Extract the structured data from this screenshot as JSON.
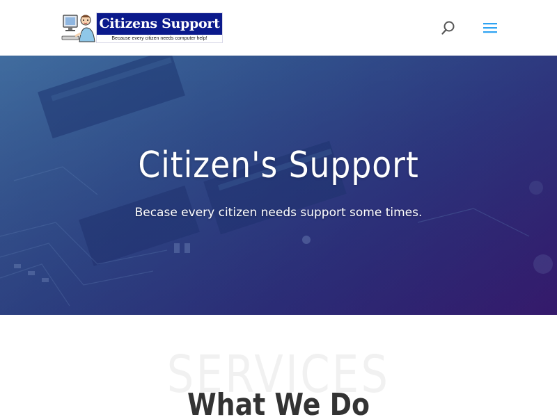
{
  "header": {
    "logo": {
      "title": "Citizens Support",
      "tagline": "Because every citizen needs computer help!"
    },
    "search_icon": "search-icon",
    "menu_icon": "hamburger-menu-icon",
    "accent_color": "#2ea3f2"
  },
  "hero": {
    "title": "Citizen's Support",
    "subtitle": "Becase every citizen needs support some times.",
    "background": "circuit-board-image"
  },
  "services": {
    "background_text": "SERVICES",
    "heading": "What We Do"
  }
}
